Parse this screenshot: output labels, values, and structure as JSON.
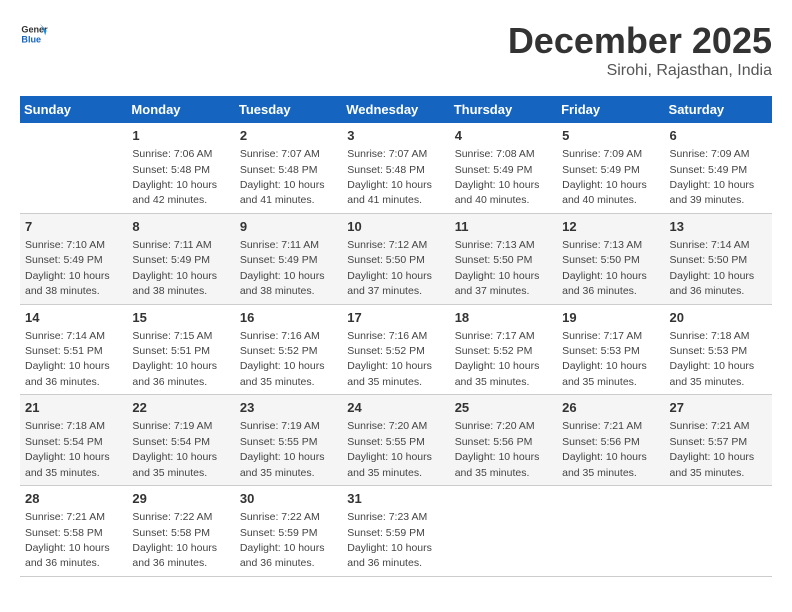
{
  "logo": {
    "general": "General",
    "blue": "Blue"
  },
  "title": "December 2025",
  "location": "Sirohi, Rajasthan, India",
  "days_header": [
    "Sunday",
    "Monday",
    "Tuesday",
    "Wednesday",
    "Thursday",
    "Friday",
    "Saturday"
  ],
  "weeks": [
    [
      {
        "day": "",
        "info": ""
      },
      {
        "day": "1",
        "info": "Sunrise: 7:06 AM\nSunset: 5:48 PM\nDaylight: 10 hours\nand 42 minutes."
      },
      {
        "day": "2",
        "info": "Sunrise: 7:07 AM\nSunset: 5:48 PM\nDaylight: 10 hours\nand 41 minutes."
      },
      {
        "day": "3",
        "info": "Sunrise: 7:07 AM\nSunset: 5:48 PM\nDaylight: 10 hours\nand 41 minutes."
      },
      {
        "day": "4",
        "info": "Sunrise: 7:08 AM\nSunset: 5:49 PM\nDaylight: 10 hours\nand 40 minutes."
      },
      {
        "day": "5",
        "info": "Sunrise: 7:09 AM\nSunset: 5:49 PM\nDaylight: 10 hours\nand 40 minutes."
      },
      {
        "day": "6",
        "info": "Sunrise: 7:09 AM\nSunset: 5:49 PM\nDaylight: 10 hours\nand 39 minutes."
      }
    ],
    [
      {
        "day": "7",
        "info": "Sunrise: 7:10 AM\nSunset: 5:49 PM\nDaylight: 10 hours\nand 38 minutes."
      },
      {
        "day": "8",
        "info": "Sunrise: 7:11 AM\nSunset: 5:49 PM\nDaylight: 10 hours\nand 38 minutes."
      },
      {
        "day": "9",
        "info": "Sunrise: 7:11 AM\nSunset: 5:49 PM\nDaylight: 10 hours\nand 38 minutes."
      },
      {
        "day": "10",
        "info": "Sunrise: 7:12 AM\nSunset: 5:50 PM\nDaylight: 10 hours\nand 37 minutes."
      },
      {
        "day": "11",
        "info": "Sunrise: 7:13 AM\nSunset: 5:50 PM\nDaylight: 10 hours\nand 37 minutes."
      },
      {
        "day": "12",
        "info": "Sunrise: 7:13 AM\nSunset: 5:50 PM\nDaylight: 10 hours\nand 36 minutes."
      },
      {
        "day": "13",
        "info": "Sunrise: 7:14 AM\nSunset: 5:50 PM\nDaylight: 10 hours\nand 36 minutes."
      }
    ],
    [
      {
        "day": "14",
        "info": "Sunrise: 7:14 AM\nSunset: 5:51 PM\nDaylight: 10 hours\nand 36 minutes."
      },
      {
        "day": "15",
        "info": "Sunrise: 7:15 AM\nSunset: 5:51 PM\nDaylight: 10 hours\nand 36 minutes."
      },
      {
        "day": "16",
        "info": "Sunrise: 7:16 AM\nSunset: 5:52 PM\nDaylight: 10 hours\nand 35 minutes."
      },
      {
        "day": "17",
        "info": "Sunrise: 7:16 AM\nSunset: 5:52 PM\nDaylight: 10 hours\nand 35 minutes."
      },
      {
        "day": "18",
        "info": "Sunrise: 7:17 AM\nSunset: 5:52 PM\nDaylight: 10 hours\nand 35 minutes."
      },
      {
        "day": "19",
        "info": "Sunrise: 7:17 AM\nSunset: 5:53 PM\nDaylight: 10 hours\nand 35 minutes."
      },
      {
        "day": "20",
        "info": "Sunrise: 7:18 AM\nSunset: 5:53 PM\nDaylight: 10 hours\nand 35 minutes."
      }
    ],
    [
      {
        "day": "21",
        "info": "Sunrise: 7:18 AM\nSunset: 5:54 PM\nDaylight: 10 hours\nand 35 minutes."
      },
      {
        "day": "22",
        "info": "Sunrise: 7:19 AM\nSunset: 5:54 PM\nDaylight: 10 hours\nand 35 minutes."
      },
      {
        "day": "23",
        "info": "Sunrise: 7:19 AM\nSunset: 5:55 PM\nDaylight: 10 hours\nand 35 minutes."
      },
      {
        "day": "24",
        "info": "Sunrise: 7:20 AM\nSunset: 5:55 PM\nDaylight: 10 hours\nand 35 minutes."
      },
      {
        "day": "25",
        "info": "Sunrise: 7:20 AM\nSunset: 5:56 PM\nDaylight: 10 hours\nand 35 minutes."
      },
      {
        "day": "26",
        "info": "Sunrise: 7:21 AM\nSunset: 5:56 PM\nDaylight: 10 hours\nand 35 minutes."
      },
      {
        "day": "27",
        "info": "Sunrise: 7:21 AM\nSunset: 5:57 PM\nDaylight: 10 hours\nand 35 minutes."
      }
    ],
    [
      {
        "day": "28",
        "info": "Sunrise: 7:21 AM\nSunset: 5:58 PM\nDaylight: 10 hours\nand 36 minutes."
      },
      {
        "day": "29",
        "info": "Sunrise: 7:22 AM\nSunset: 5:58 PM\nDaylight: 10 hours\nand 36 minutes."
      },
      {
        "day": "30",
        "info": "Sunrise: 7:22 AM\nSunset: 5:59 PM\nDaylight: 10 hours\nand 36 minutes."
      },
      {
        "day": "31",
        "info": "Sunrise: 7:23 AM\nSunset: 5:59 PM\nDaylight: 10 hours\nand 36 minutes."
      },
      {
        "day": "",
        "info": ""
      },
      {
        "day": "",
        "info": ""
      },
      {
        "day": "",
        "info": ""
      }
    ]
  ]
}
